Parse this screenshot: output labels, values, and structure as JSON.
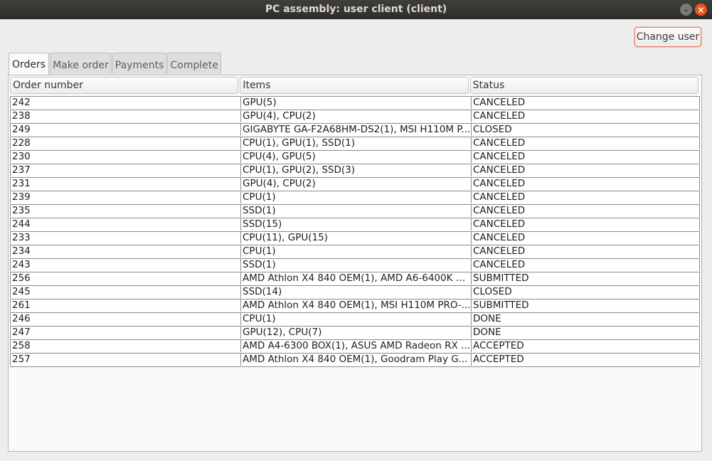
{
  "window": {
    "title": "PC assembly: user client (client)"
  },
  "toolbar": {
    "change_user_label": "Change user"
  },
  "tabs": [
    {
      "label": "Orders",
      "active": true
    },
    {
      "label": "Make order",
      "active": false
    },
    {
      "label": "Payments",
      "active": false
    },
    {
      "label": "Complete",
      "active": false
    }
  ],
  "table": {
    "columns": [
      "Order number",
      "Items",
      "Status"
    ],
    "rows": [
      [
        "242",
        "GPU(5)",
        "CANCELED"
      ],
      [
        "238",
        "GPU(4), CPU(2)",
        "CANCELED"
      ],
      [
        "249",
        "GIGABYTE GA-F2A68HM-DS2(1), MSI H110M P...",
        "CLOSED"
      ],
      [
        "228",
        "CPU(1), GPU(1), SSD(1)",
        "CANCELED"
      ],
      [
        "230",
        "CPU(4), GPU(5)",
        "CANCELED"
      ],
      [
        "237",
        "CPU(1), GPU(2), SSD(3)",
        "CANCELED"
      ],
      [
        "231",
        "GPU(4), CPU(2)",
        "CANCELED"
      ],
      [
        "239",
        "CPU(1)",
        "CANCELED"
      ],
      [
        "235",
        "SSD(1)",
        "CANCELED"
      ],
      [
        "244",
        "SSD(15)",
        "CANCELED"
      ],
      [
        "233",
        "CPU(11), GPU(15)",
        "CANCELED"
      ],
      [
        "234",
        "CPU(1)",
        "CANCELED"
      ],
      [
        "243",
        "SSD(1)",
        "CANCELED"
      ],
      [
        "256",
        "AMD Athlon X4 840 OEM(1), AMD A6-6400K O...",
        "SUBMITTED"
      ],
      [
        "245",
        "SSD(14)",
        "CLOSED"
      ],
      [
        "261",
        "AMD Athlon X4 840 OEM(1), MSI H110M PRO-...",
        "SUBMITTED"
      ],
      [
        "246",
        "CPU(1)",
        "DONE"
      ],
      [
        "247",
        "GPU(12), CPU(7)",
        "DONE"
      ],
      [
        "258",
        "AMD A4-6300 BOX(1), ASUS AMD Radeon RX ...",
        "ACCEPTED"
      ],
      [
        "257",
        "AMD Athlon X4 840 OEM(1), Goodram Play G...",
        "ACCEPTED"
      ]
    ]
  }
}
